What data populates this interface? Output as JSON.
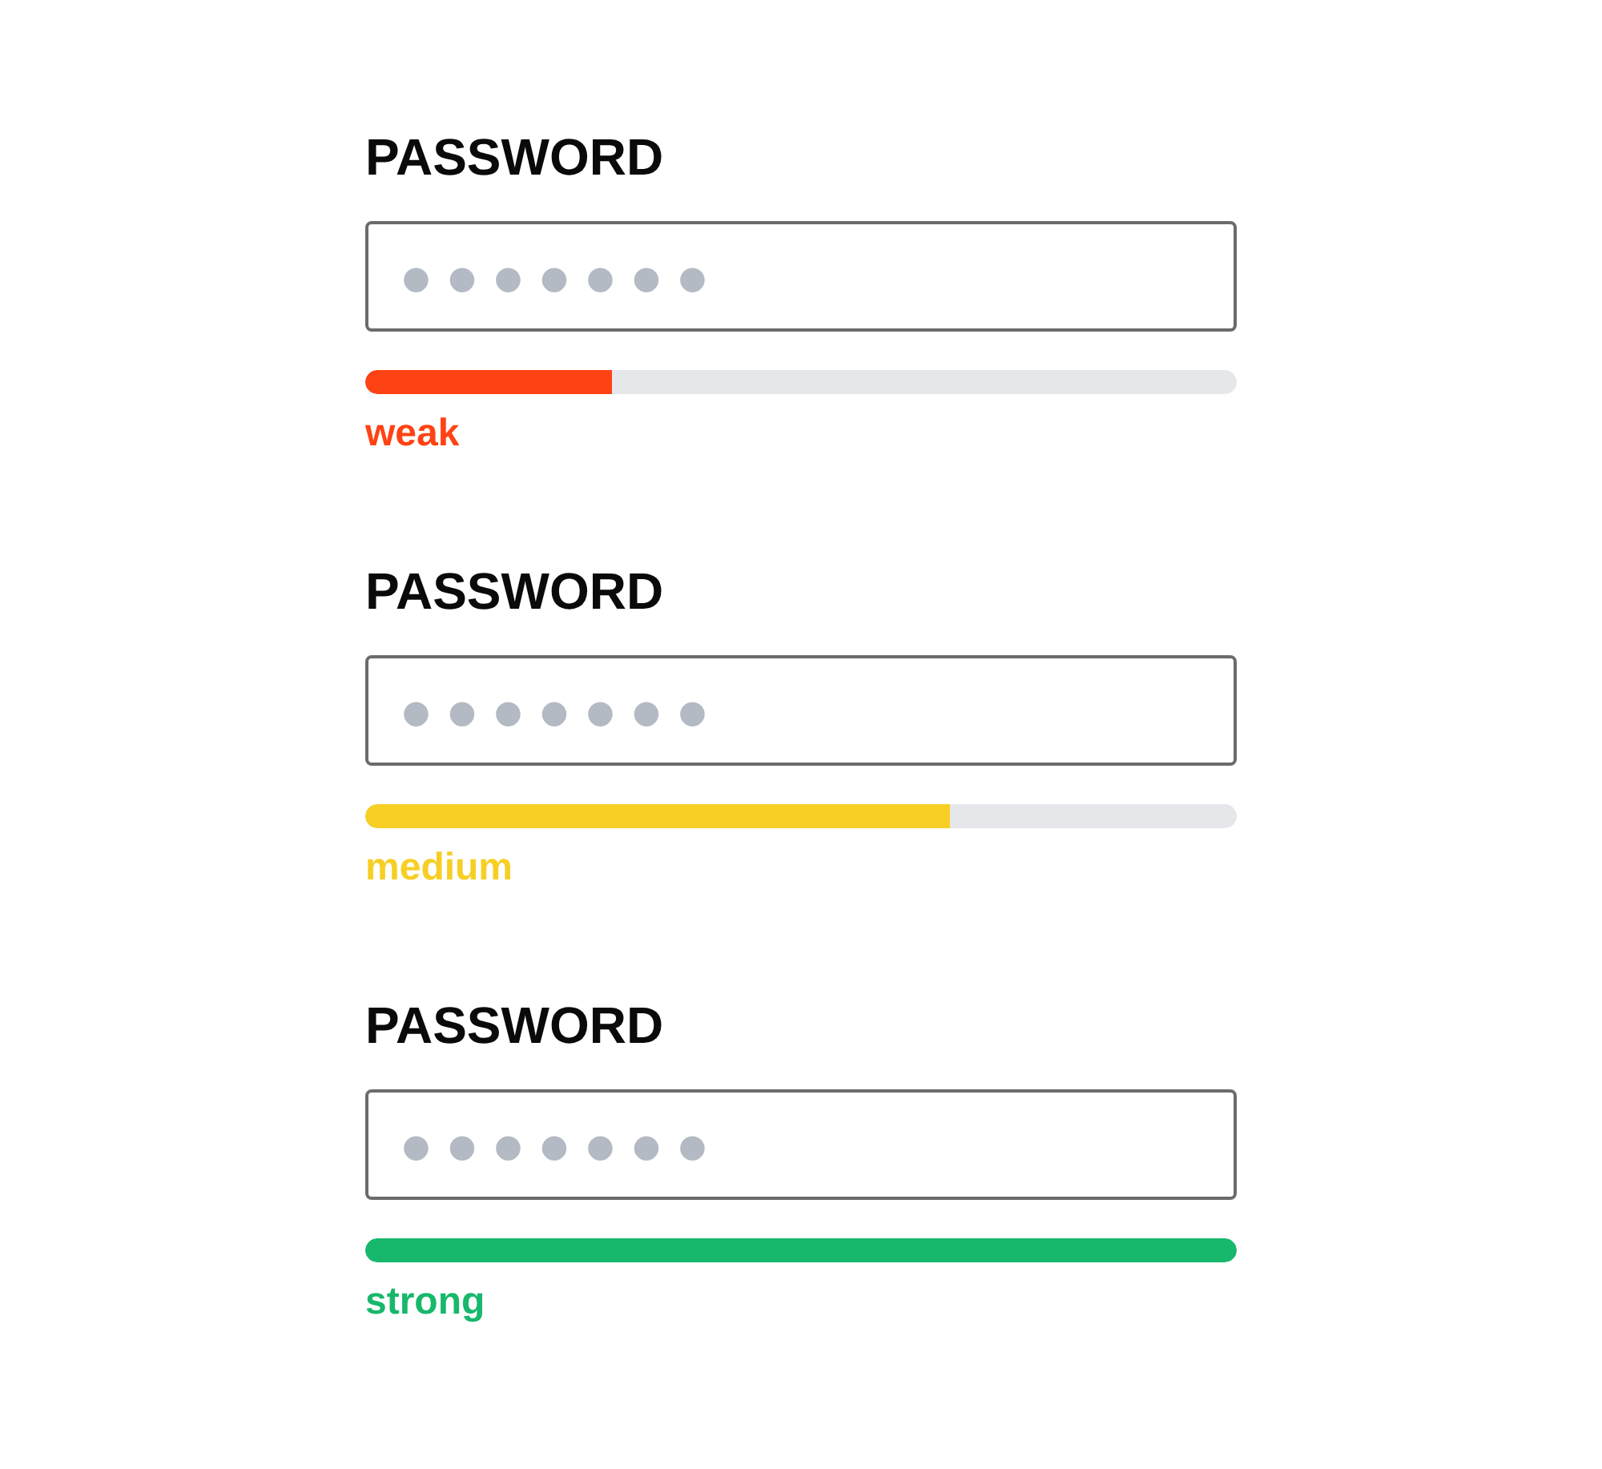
{
  "fields": [
    {
      "label": "PASSWORD",
      "value": "●●●●●●●",
      "level": 0.283,
      "strength": "weak",
      "color": "#ff4214"
    },
    {
      "label": "PASSWORD",
      "value": "●●●●●●●",
      "level": 0.671,
      "strength": "medium",
      "color": "#f7cf24"
    },
    {
      "label": "PASSWORD",
      "value": "●●●●●●●",
      "level": 1,
      "strength": "strong",
      "color": "#17b86b"
    }
  ]
}
